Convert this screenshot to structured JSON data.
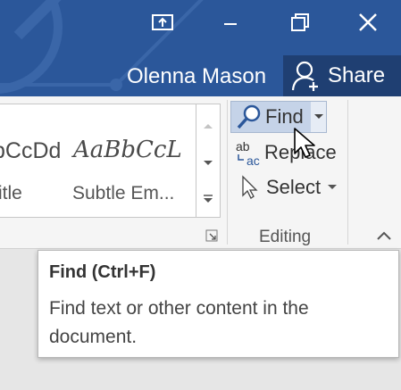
{
  "titlebar": {
    "user_name": "Olenna Mason",
    "share_label": "Share",
    "accent_color": "#2b579a"
  },
  "window_controls": [
    "ribbon-display-options-icon",
    "minimize-icon",
    "restore-icon",
    "close-icon"
  ],
  "styles_gallery": {
    "items": [
      {
        "sample": "bCcDd",
        "name": "itle"
      },
      {
        "sample": "AaBbCcL",
        "name": "Subtle Em..."
      }
    ]
  },
  "editing": {
    "find_label": "Find",
    "replace_label": "Replace",
    "select_label": "Select",
    "group_label": "Editing"
  },
  "tooltip": {
    "title": "Find (Ctrl+F)",
    "description": "Find text or other content in the document."
  }
}
